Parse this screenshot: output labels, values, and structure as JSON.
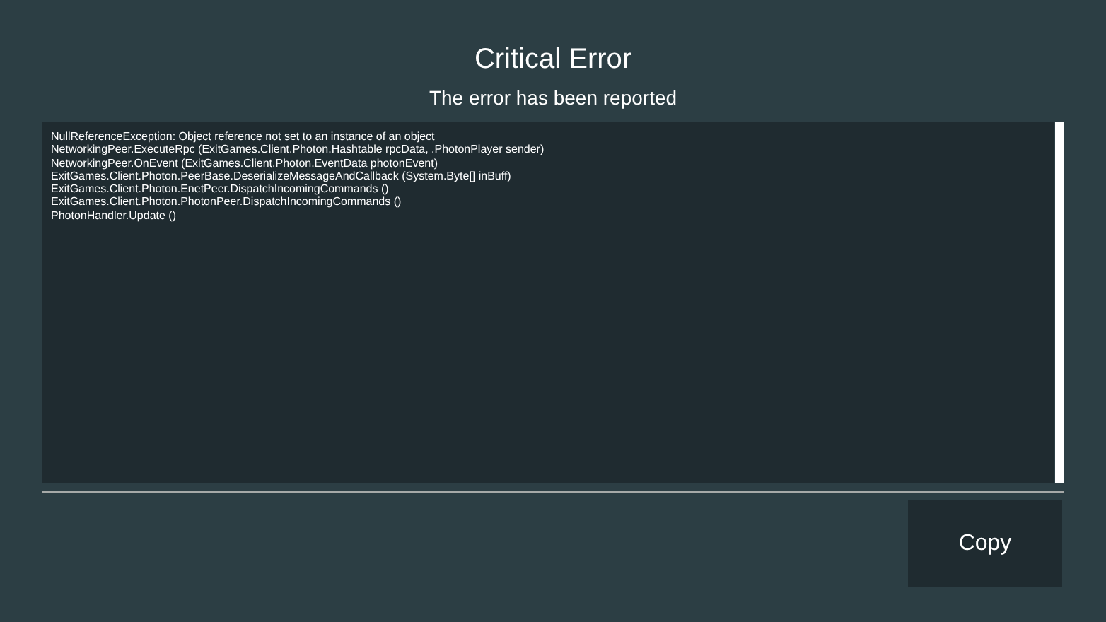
{
  "title": "Critical Error",
  "subtitle": "The error has been reported",
  "log": [
    "NullReferenceException: Object reference not set to an instance of an object",
    "NetworkingPeer.ExecuteRpc (ExitGames.Client.Photon.Hashtable rpcData, .PhotonPlayer sender)",
    "NetworkingPeer.OnEvent (ExitGames.Client.Photon.EventData photonEvent)",
    "ExitGames.Client.Photon.PeerBase.DeserializeMessageAndCallback (System.Byte[] inBuff)",
    "ExitGames.Client.Photon.EnetPeer.DispatchIncomingCommands ()",
    "ExitGames.Client.Photon.PhotonPeer.DispatchIncomingCommands ()",
    "PhotonHandler.Update ()"
  ],
  "button": "Copy"
}
